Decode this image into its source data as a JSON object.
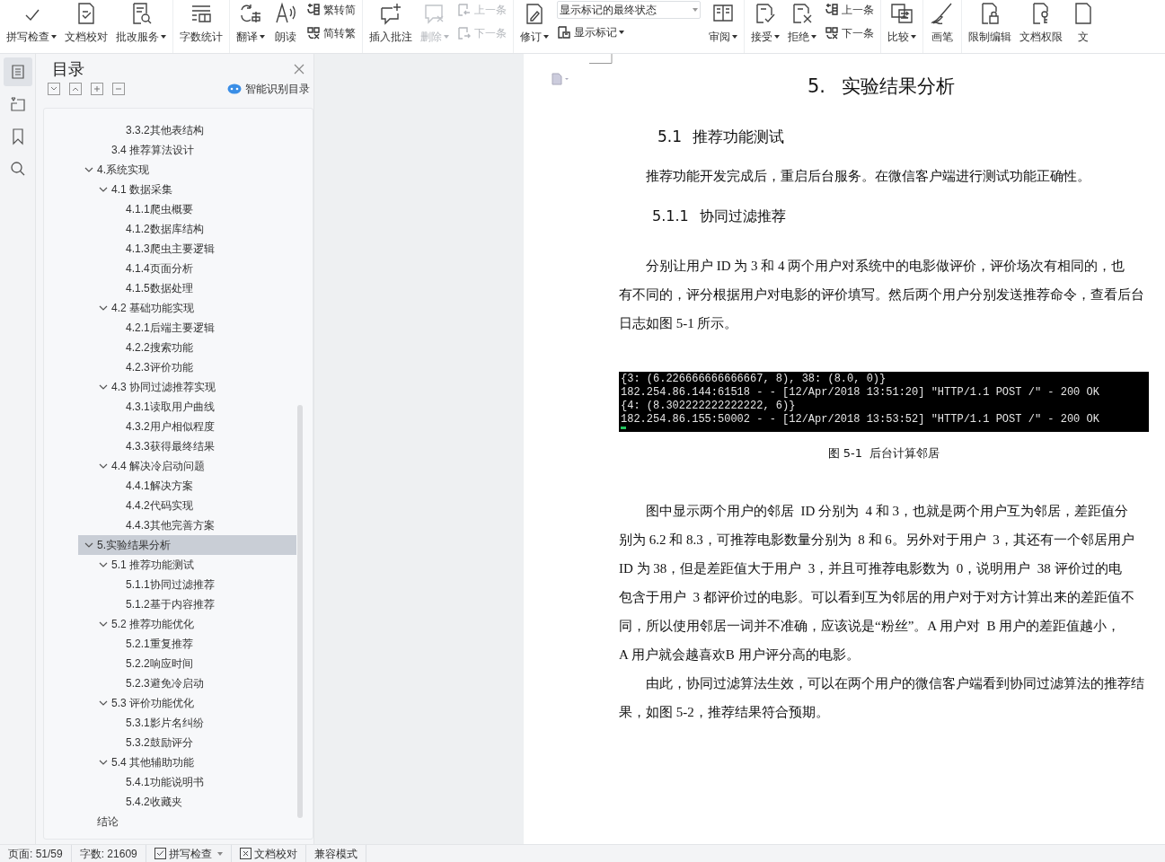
{
  "toolbar": {
    "groups": [
      [
        {
          "kind": "big",
          "label": "拼写检查",
          "dropdown": true,
          "disabled": false
        },
        {
          "kind": "big",
          "label": "文档校对",
          "dropdown": false,
          "disabled": false
        },
        {
          "kind": "big",
          "label": "批改服务",
          "dropdown": true,
          "disabled": false
        }
      ],
      [
        {
          "kind": "big",
          "label": "字数统计",
          "dropdown": false,
          "disabled": false
        }
      ],
      [
        {
          "kind": "big",
          "label": "翻译",
          "dropdown": true,
          "disabled": false
        },
        {
          "kind": "big",
          "label": "朗读",
          "dropdown": false,
          "disabled": false
        },
        {
          "kind": "stack",
          "items": [
            {
              "label": "繁转简",
              "disabled": false
            },
            {
              "label": "简转繁",
              "disabled": false
            }
          ]
        }
      ],
      [
        {
          "kind": "big",
          "label": "插入批注",
          "dropdown": false,
          "disabled": false
        },
        {
          "kind": "big",
          "label": "删除",
          "dropdown": true,
          "disabled": true
        },
        {
          "kind": "stack",
          "items": [
            {
              "label": "上一条",
              "disabled": true
            },
            {
              "label": "下一条",
              "disabled": true
            }
          ]
        }
      ],
      [
        {
          "kind": "big",
          "label": "修订",
          "dropdown": true,
          "disabled": false
        },
        {
          "kind": "select",
          "value": "显示标记的最终状态",
          "below": "显示标记"
        },
        {
          "kind": "big",
          "label": "审阅",
          "dropdown": true,
          "disabled": false
        }
      ],
      [
        {
          "kind": "big",
          "label": "接受",
          "dropdown": true,
          "disabled": false
        },
        {
          "kind": "big",
          "label": "拒绝",
          "dropdown": true,
          "disabled": false
        },
        {
          "kind": "stack",
          "items": [
            {
              "label": "上一条",
              "disabled": false
            },
            {
              "label": "下一条",
              "disabled": false
            }
          ]
        }
      ],
      [
        {
          "kind": "big",
          "label": "比较",
          "dropdown": true,
          "disabled": false
        }
      ],
      [
        {
          "kind": "big",
          "label": "画笔",
          "dropdown": false,
          "disabled": false
        }
      ],
      [
        {
          "kind": "big",
          "label": "限制编辑",
          "dropdown": false,
          "disabled": false
        },
        {
          "kind": "big",
          "label": "文档权限",
          "dropdown": false,
          "disabled": false
        },
        {
          "kind": "big",
          "label": "文",
          "dropdown": false,
          "disabled": false
        }
      ]
    ]
  },
  "side_rail": [
    {
      "selected": true
    },
    {
      "selected": false
    },
    {
      "selected": false
    },
    {
      "selected": false
    }
  ],
  "toc_panel": {
    "title": "目录",
    "smart_button": "智能识别目录",
    "tree": [
      {
        "children": [
          {
            "children": [
              {
                "label": "3.3.2其他表结构",
                "selected": false
              }
            ]
          },
          {
            "label": "3.4 推荐算法设计",
            "selected": false
          }
        ]
      },
      {
        "label": "4.系统实现",
        "selected": false,
        "expanded": true,
        "children": [
          {
            "label": "4.1 数据采集",
            "selected": false,
            "expanded": true,
            "children": [
              {
                "label": "4.1.1爬虫概要",
                "selected": false
              },
              {
                "label": "4.1.2数据库结构",
                "selected": false
              },
              {
                "label": "4.1.3爬虫主要逻辑",
                "selected": false
              },
              {
                "label": "4.1.4页面分析",
                "selected": false
              },
              {
                "label": "4.1.5数据处理",
                "selected": false
              }
            ]
          },
          {
            "label": "4.2 基础功能实现",
            "selected": false,
            "expanded": true,
            "children": [
              {
                "label": "4.2.1后端主要逻辑",
                "selected": false
              },
              {
                "label": "4.2.2搜索功能",
                "selected": false
              },
              {
                "label": "4.2.3评价功能",
                "selected": false
              }
            ]
          },
          {
            "label": "4.3 协同过滤推荐实现",
            "selected": false,
            "expanded": true,
            "children": [
              {
                "label": "4.3.1读取用户曲线",
                "selected": false
              },
              {
                "label": "4.3.2用户相似程度",
                "selected": false
              },
              {
                "label": "4.3.3获得最终结果",
                "selected": false
              }
            ]
          },
          {
            "label": "4.4 解决冷启动问题",
            "selected": false,
            "expanded": true,
            "children": [
              {
                "label": "4.4.1解决方案",
                "selected": false
              },
              {
                "label": "4.4.2代码实现",
                "selected": false
              },
              {
                "label": "4.4.3其他完善方案",
                "selected": false
              }
            ]
          }
        ]
      },
      {
        "label": "5.实验结果分析",
        "selected": true,
        "expanded": true,
        "children": [
          {
            "label": "5.1 推荐功能测试",
            "selected": false,
            "expanded": true,
            "children": [
              {
                "label": "5.1.1协同过滤推荐",
                "selected": false
              },
              {
                "label": "5.1.2基于内容推荐",
                "selected": false
              }
            ]
          },
          {
            "label": "5.2 推荐功能优化",
            "selected": false,
            "expanded": true,
            "children": [
              {
                "label": "5.2.1重复推荐",
                "selected": false
              },
              {
                "label": "5.2.2响应时间",
                "selected": false
              },
              {
                "label": "5.2.3避免冷启动",
                "selected": false
              }
            ]
          },
          {
            "label": "5.3 评价功能优化",
            "selected": false,
            "expanded": true,
            "children": [
              {
                "label": "5.3.1影片名纠纷",
                "selected": false
              },
              {
                "label": "5.3.2鼓励评分",
                "selected": false
              }
            ]
          },
          {
            "label": "5.4 其他辅助功能",
            "selected": false,
            "expanded": true,
            "children": [
              {
                "label": "5.4.1功能说明书",
                "selected": false
              },
              {
                "label": "5.4.2收藏夹",
                "selected": false
              }
            ]
          }
        ]
      },
      {
        "label": "结论",
        "selected": false
      }
    ]
  },
  "document": {
    "blocks": [
      {
        "kind": "heading1",
        "number": "5.",
        "text": "实验结果分析"
      },
      {
        "kind": "heading2",
        "number": "5.1",
        "text": "推荐功能测试"
      },
      {
        "kind": "para",
        "lines": [
          "推荐功能开发完成后，重启后台服务。在微信客户端进行测试功能正确性。"
        ]
      },
      {
        "kind": "heading3",
        "number": "5.1.1",
        "text": "协同过滤推荐"
      },
      {
        "kind": "para",
        "lines": [
          "分别让用户 ID 为 3 和 4 两个用户对系统中的电影做评价，评价场次有相同的，也",
          "有不同的，评分根据用户对电影的评价填写。然后两个用户分别发送推荐命令，查看后台",
          "日志如图 5-1 所示。"
        ]
      },
      {
        "kind": "console",
        "lines": [
          "{3: (6.226666666666667, 8), 38: (8.0, 0)}",
          "182.254.86.144:61518 - - [12/Apr/2018 13:51:20] \"HTTP/1.1 POST /\" - 200 OK",
          "{4: (8.302222222222222, 6)}",
          "182.254.86.155:50002 - - [12/Apr/2018 13:53:52] \"HTTP/1.1 POST /\" - 200 OK"
        ]
      },
      {
        "kind": "caption",
        "text": "图 5-1  后台计算邻居"
      },
      {
        "kind": "para",
        "lines": [
          "图中显示两个用户的邻居  ID 分别为  4 和 3，也就是两个用户互为邻居，差距值分",
          "别为 6.2 和 8.3，可推荐电影数量分别为  8 和 6。另外对于用户  3，其还有一个邻居用户",
          "ID 为 38，但是差距值大于用户  3，并且可推荐电影数为  0，说明用户  38 评价过的电",
          "包含于用户  3 都评价过的电影。可以看到互为邻居的用户对于对方计算出来的差距值不",
          "同，所以使用邻居一词并不准确，应该说是“粉丝”。A 用户对  B 用户的差距值越小，",
          "A 用户就会越喜欢B 用户评分高的电影。"
        ]
      },
      {
        "kind": "para",
        "lines": [
          "由此，协同过滤算法生效，可以在两个用户的微信客户端看到协同过滤算法的推荐结",
          "果，如图 5-2，推荐结果符合预期。"
        ]
      }
    ]
  },
  "status_bar": {
    "page": "页面: 51/59",
    "words": "字数: 21609",
    "spell_check": "拼写检查",
    "proofread": "文档校对",
    "mode": "兼容模式"
  }
}
